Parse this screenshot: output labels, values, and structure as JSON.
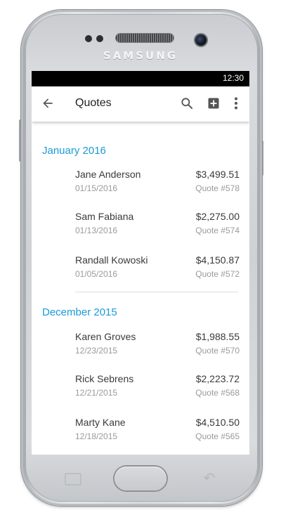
{
  "device": {
    "brand": "SAMSUNG"
  },
  "status_bar": {
    "time": "12:30"
  },
  "app_bar": {
    "title": "Quotes",
    "icons": [
      "back-arrow-icon",
      "search-icon",
      "add-box-icon",
      "more-vert-icon"
    ]
  },
  "colors": {
    "accent": "#1a9bd7",
    "status_bar": "#000000",
    "primary_text": "#3a3a3a",
    "secondary_text": "#9a9a9a"
  },
  "sections": [
    {
      "title": "January 2016",
      "items": [
        {
          "name": "Jane Anderson",
          "amount": "$3,499.51",
          "date": "01/15/2016",
          "quote": "Quote #578"
        },
        {
          "name": "Sam Fabiana",
          "amount": "$2,275.00",
          "date": "01/13/2016",
          "quote": "Quote #574"
        },
        {
          "name": "Randall Kowoski",
          "amount": "$4,150.87",
          "date": "01/05/2016",
          "quote": "Quote #572"
        }
      ]
    },
    {
      "title": "December 2015",
      "items": [
        {
          "name": "Karen Groves",
          "amount": "$1,988.55",
          "date": "12/23/2015",
          "quote": "Quote #570"
        },
        {
          "name": "Rick Sebrens",
          "amount": "$2,223.72",
          "date": "12/21/2015",
          "quote": "Quote #568"
        },
        {
          "name": "Marty Kane",
          "amount": "$4,510.50",
          "date": "12/18/2015",
          "quote": "Quote #565"
        }
      ]
    }
  ]
}
